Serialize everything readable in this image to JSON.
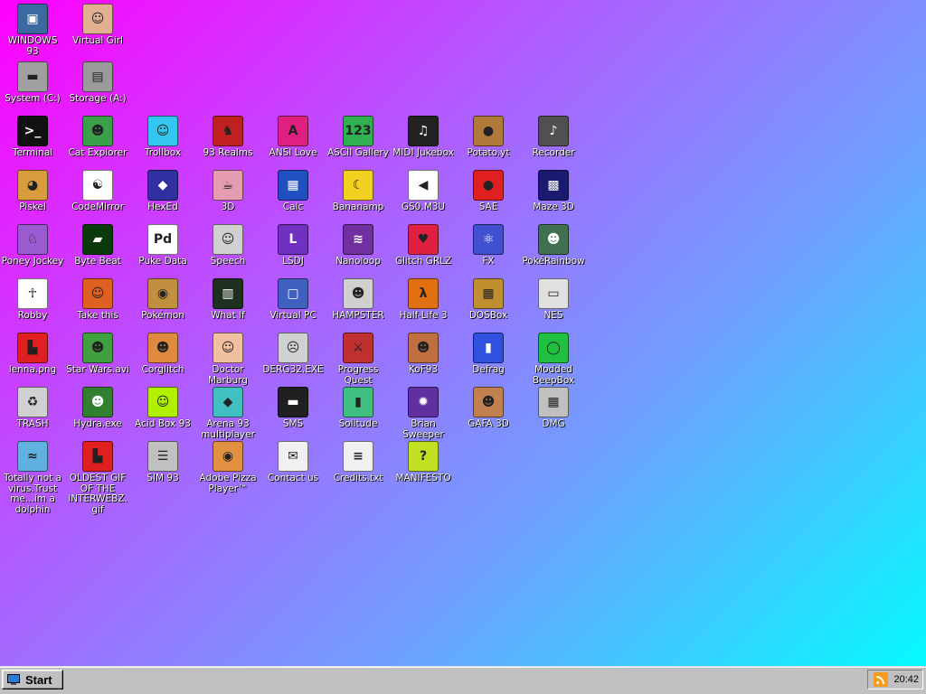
{
  "desktop": {
    "icons": [
      {
        "label": "WINDOWS 93",
        "icon": "computer-icon",
        "glyph": "▣",
        "color": "#3b6aa0"
      },
      {
        "label": "Virtual Girl",
        "icon": "face-icon",
        "glyph": "☺",
        "color": "#e0b090"
      },
      {
        "label": "System (C:)",
        "icon": "hard-drive-icon",
        "glyph": "▬",
        "color": "#a0a0a0"
      },
      {
        "label": "Storage (A:)",
        "icon": "floppy-drive-icon",
        "glyph": "▤",
        "color": "#9a9a9a"
      },
      {
        "label": "Terminal",
        "icon": "terminal-icon",
        "glyph": ">_",
        "color": "#111111"
      },
      {
        "label": "Cat Explorer",
        "icon": "cat-globe-icon",
        "glyph": "☻",
        "color": "#3aa04a"
      },
      {
        "label": "Trollbox",
        "icon": "chat-bubble-icon",
        "glyph": "☺",
        "color": "#33c6ee"
      },
      {
        "label": "93 Realms",
        "icon": "knight-icon",
        "glyph": "♞",
        "color": "#c02020"
      },
      {
        "label": "ANSI Love",
        "icon": "text-a-icon",
        "glyph": "A",
        "color": "#e02080"
      },
      {
        "label": "ASCII Gallery",
        "icon": "numbers-icon",
        "glyph": "123",
        "color": "#30b050"
      },
      {
        "label": "MIDI Jukebox",
        "icon": "piano-icon",
        "glyph": "♫",
        "color": "#222222"
      },
      {
        "label": "Potato.yt",
        "icon": "potato-icon",
        "glyph": "●",
        "color": "#b07a3a"
      },
      {
        "label": "Recorder",
        "icon": "microphone-icon",
        "glyph": "♪",
        "color": "#505050"
      },
      {
        "label": "Piskel",
        "icon": "palette-icon",
        "glyph": "◕",
        "color": "#d89b3e"
      },
      {
        "label": "CodeMirror",
        "icon": "code-cat-icon",
        "glyph": "☯",
        "color": "#ffffff"
      },
      {
        "label": "HexEd",
        "icon": "cube-icon",
        "glyph": "◆",
        "color": "#3030a0"
      },
      {
        "label": "3D",
        "icon": "teapot-icon",
        "glyph": "☕",
        "color": "#e59cb0"
      },
      {
        "label": "Calc",
        "icon": "calculator-icon",
        "glyph": "▦",
        "color": "#2050c0"
      },
      {
        "label": "Bananamp",
        "icon": "banana-icon",
        "glyph": "☾",
        "color": "#f2d020"
      },
      {
        "label": "GS0.M3U",
        "icon": "audio-file-icon",
        "glyph": "◀",
        "color": "#ffffff"
      },
      {
        "label": "SAE",
        "icon": "checkered-ball-icon",
        "glyph": "●",
        "color": "#e02020"
      },
      {
        "label": "Maze 3D",
        "icon": "maze-icon",
        "glyph": "▩",
        "color": "#1a1a70"
      },
      {
        "label": "Poney Jockey",
        "icon": "pony-icon",
        "glyph": "♘",
        "color": "#9a5ad0"
      },
      {
        "label": "Byte Beat",
        "icon": "wave-icon",
        "glyph": "▰",
        "color": "#0a3a0a"
      },
      {
        "label": "Puke Data",
        "icon": "pd-icon",
        "glyph": "Pd",
        "color": "#ffffff"
      },
      {
        "label": "Speech",
        "icon": "speaking-face-icon",
        "glyph": "☺",
        "color": "#d0d0d0"
      },
      {
        "label": "LSDJ",
        "icon": "lsdj-icon",
        "glyph": "L",
        "color": "#7030c0"
      },
      {
        "label": "Nanoloop",
        "icon": "waveform-icon",
        "glyph": "≋",
        "color": "#7030a0"
      },
      {
        "label": "Glitch GRLZ",
        "icon": "lips-icon",
        "glyph": "♥",
        "color": "#e02040"
      },
      {
        "label": "FX",
        "icon": "atom-icon",
        "glyph": "⚛",
        "color": "#4050d0"
      },
      {
        "label": "PokéRainbow",
        "icon": "creatures-icon",
        "glyph": "☻",
        "color": "#407050"
      },
      {
        "label": "Robby",
        "icon": "stick-figure-icon",
        "glyph": "☥",
        "color": "#ffffff"
      },
      {
        "label": "Take this",
        "icon": "old-man-icon",
        "glyph": "☺",
        "color": "#e06020"
      },
      {
        "label": "Pokémon",
        "icon": "pokeball-icon",
        "glyph": "◉",
        "color": "#c09040"
      },
      {
        "label": "What If",
        "icon": "matrix-icon",
        "glyph": "▥",
        "color": "#203020"
      },
      {
        "label": "Virtual PC",
        "icon": "window-icon",
        "glyph": "▢",
        "color": "#4060c0"
      },
      {
        "label": "HAMPSTER",
        "icon": "hamster-icon",
        "glyph": "☻",
        "color": "#d0d0d0"
      },
      {
        "label": "Half-Life 3",
        "icon": "lambda-icon",
        "glyph": "λ",
        "color": "#e07010"
      },
      {
        "label": "DOSBox",
        "icon": "dosbox-icon",
        "glyph": "▦",
        "color": "#c09030"
      },
      {
        "label": "NES",
        "icon": "nes-console-icon",
        "glyph": "▭",
        "color": "#e0e0e0"
      },
      {
        "label": "lenna.png",
        "icon": "image-file-icon",
        "glyph": "▙",
        "color": "#e02020"
      },
      {
        "label": "Star Wars.avi",
        "icon": "yoda-icon",
        "glyph": "☻",
        "color": "#40a040"
      },
      {
        "label": "Corglitch",
        "icon": "corgi-icon",
        "glyph": "☻",
        "color": "#e08a40"
      },
      {
        "label": "Doctor Marburg",
        "icon": "doctor-icon",
        "glyph": "☺",
        "color": "#f0c0a0"
      },
      {
        "label": "DERG32.EXE",
        "icon": "monitor-face-icon",
        "glyph": "☹",
        "color": "#d0d0d0"
      },
      {
        "label": "Progress Quest",
        "icon": "crossed-swords-icon",
        "glyph": "⚔",
        "color": "#c03030"
      },
      {
        "label": "KoF93",
        "icon": "fighter-icon",
        "glyph": "☻",
        "color": "#c07040"
      },
      {
        "label": "Defrag",
        "icon": "defrag-icon",
        "glyph": "▮",
        "color": "#3050e0"
      },
      {
        "label": "Modded BeepBox",
        "icon": "ring-icon",
        "glyph": "◯",
        "color": "#20c040"
      },
      {
        "label": "TRASH",
        "icon": "recycle-bin-icon",
        "glyph": "♻",
        "color": "#d0d0d0"
      },
      {
        "label": "Hydra.exe",
        "icon": "dragon-icon",
        "glyph": "☻",
        "color": "#308030"
      },
      {
        "label": "Acid Box 93",
        "icon": "smiley-icon",
        "glyph": "☺",
        "color": "#b0f000"
      },
      {
        "label": "Arena 93 multiplayer",
        "icon": "cube-3d-icon",
        "glyph": "◆",
        "color": "#40c0c0"
      },
      {
        "label": "SMS",
        "icon": "sms-console-icon",
        "glyph": "▬",
        "color": "#202020"
      },
      {
        "label": "Solitude",
        "icon": "bottle-icon",
        "glyph": "▮",
        "color": "#40c080"
      },
      {
        "label": "Brian Sweeper",
        "icon": "mine-icon",
        "glyph": "✹",
        "color": "#6030a0"
      },
      {
        "label": "GAFA 3D",
        "icon": "doom-face-icon",
        "glyph": "☻",
        "color": "#c08050"
      },
      {
        "label": "DMG",
        "icon": "gameboy-icon",
        "glyph": "▦",
        "color": "#c0c0c0"
      },
      {
        "label": "Totally not a virus.Trust me...im a dolphin",
        "icon": "dolphin-icon",
        "glyph": "≈",
        "color": "#60b0e0"
      },
      {
        "label": "OLDEST GIF OF THE INTERWEBZ.gif",
        "icon": "gif-file-icon",
        "glyph": "▙",
        "color": "#e02020"
      },
      {
        "label": "SIM 93",
        "icon": "book-icon",
        "glyph": "☰",
        "color": "#c0c0c0"
      },
      {
        "label": "Adobe Pizza Player™",
        "icon": "pizza-icon",
        "glyph": "◉",
        "color": "#e09040"
      },
      {
        "label": "Contact us",
        "icon": "mail-pen-icon",
        "glyph": "✉",
        "color": "#f0f0f0"
      },
      {
        "label": "Credits.txt",
        "icon": "text-file-icon",
        "glyph": "≡",
        "color": "#f0f0f0"
      },
      {
        "label": "MANIFESTO",
        "icon": "question-mark-icon",
        "glyph": "?",
        "color": "#c0e020"
      }
    ]
  },
  "taskbar": {
    "start_label": "Start",
    "clock": "20:42"
  }
}
